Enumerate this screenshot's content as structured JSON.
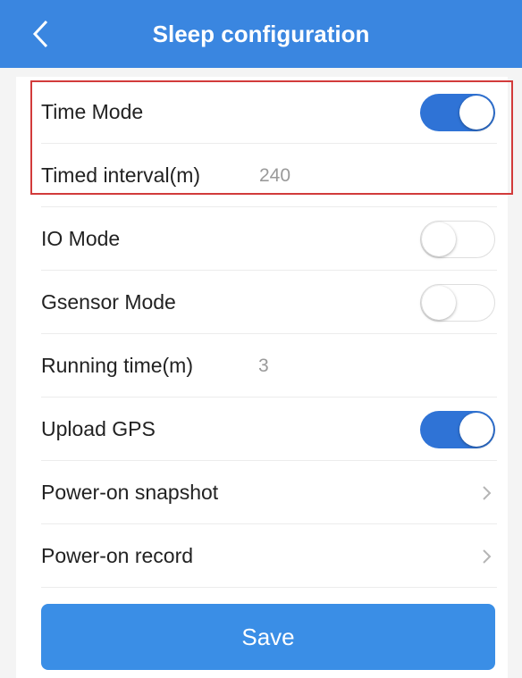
{
  "header": {
    "title": "Sleep configuration",
    "back_icon": "chevron-left-icon"
  },
  "rows": {
    "time_mode": {
      "label": "Time Mode",
      "toggle": "on"
    },
    "timed_interval": {
      "label": "Timed interval(m)",
      "value": "240"
    },
    "io_mode": {
      "label": "IO Mode",
      "toggle": "off"
    },
    "gsensor_mode": {
      "label": "Gsensor Mode",
      "toggle": "off"
    },
    "running_time": {
      "label": "Running time(m)",
      "value": "3"
    },
    "upload_gps": {
      "label": "Upload GPS",
      "toggle": "on"
    },
    "power_on_snapshot": {
      "label": "Power-on snapshot",
      "icon": "chevron-right-icon"
    },
    "power_on_record": {
      "label": "Power-on record",
      "icon": "chevron-right-icon"
    }
  },
  "save_label": "Save",
  "colors": {
    "header_bg": "#3a86e0",
    "toggle_on": "#2f73d6",
    "save_bg": "#3a8ee6",
    "highlight_border": "#d23b3b"
  }
}
